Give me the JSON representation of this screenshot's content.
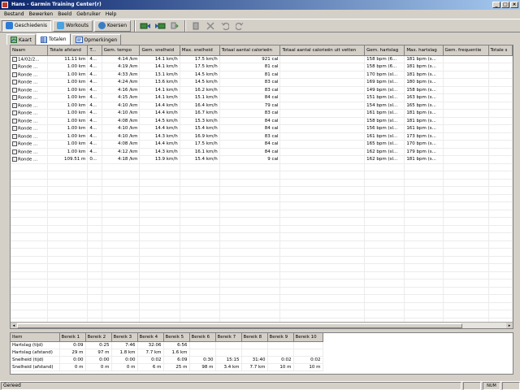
{
  "window": {
    "title": "Hans - Garmin Training Center(r)",
    "min": "_",
    "max": "□",
    "close": "×"
  },
  "menu": [
    "Bestand",
    "Bewerken",
    "Beeld",
    "Gebruiker",
    "Help"
  ],
  "toolbar": {
    "tabs": [
      {
        "label": "Geschiedenis",
        "active": true,
        "color": "#2e7bd6"
      },
      {
        "label": "Workouts",
        "active": false,
        "color": "#4aa3e0"
      },
      {
        "label": "Koersen",
        "active": false,
        "color": "#3b7dc4"
      }
    ]
  },
  "subtabs": [
    {
      "label": "Kaart",
      "active": false
    },
    {
      "label": "Totalen",
      "active": true
    },
    {
      "label": "Opmerkingen",
      "active": false
    }
  ],
  "grid": {
    "columns": [
      "Naam",
      "Totale afstand",
      "T...",
      "Gem. tempo",
      "Gem. snelheid",
      "Max. snelheid",
      "Totaal aantal calorieën",
      "Totaal aantal calorieën uit vetten",
      "Gem. hartslag",
      "Max. hartslag",
      "Gem. frequentie",
      "Totale s"
    ],
    "rows": [
      [
        "14/02/2...",
        "11.11 km",
        "4...",
        "4:14 /km",
        "14.1 km/h",
        "17.5 km/h",
        "921 cal",
        "",
        "158 bpm (6...",
        "181 bpm (s...",
        "",
        ""
      ],
      [
        "Ronde ...",
        "1.00 km",
        "4...",
        "4:19 /km",
        "14.1 km/h",
        "17.5 km/h",
        "81 cal",
        "",
        "158 bpm (6...",
        "181 bpm (s...",
        "",
        ""
      ],
      [
        "Ronde ...",
        "1.00 km",
        "4...",
        "4:33 /km",
        "13.1 km/h",
        "14.5 km/h",
        "81 cal",
        "",
        "170 bpm (sl...",
        "181 bpm (s...",
        "",
        ""
      ],
      [
        "Ronde ...",
        "1.00 km",
        "4...",
        "4:24 /km",
        "13.6 km/h",
        "14.5 km/h",
        "83 cal",
        "",
        "169 bpm (sl...",
        "180 bpm (s...",
        "",
        ""
      ],
      [
        "Ronde ...",
        "1.00 km",
        "4...",
        "4:16 /km",
        "14.1 km/h",
        "16.2 km/h",
        "83 cal",
        "",
        "149 bpm (sl...",
        "158 bpm (s...",
        "",
        ""
      ],
      [
        "Ronde ...",
        "1.00 km",
        "4...",
        "4:15 /km",
        "14.1 km/h",
        "15.1 km/h",
        "84 cal",
        "",
        "151 bpm (sl...",
        "163 bpm (s...",
        "",
        ""
      ],
      [
        "Ronde ...",
        "1.00 km",
        "4...",
        "4:10 /km",
        "14.4 km/h",
        "16.4 km/h",
        "79 cal",
        "",
        "154 bpm (sl...",
        "165 bpm (s...",
        "",
        ""
      ],
      [
        "Ronde ...",
        "1.00 km",
        "4...",
        "4:10 /km",
        "14.4 km/h",
        "16.7 km/h",
        "83 cal",
        "",
        "161 bpm (sl...",
        "181 bpm (s...",
        "",
        ""
      ],
      [
        "Ronde ...",
        "1.00 km",
        "4...",
        "4:08 /km",
        "14.5 km/h",
        "15.3 km/h",
        "84 cal",
        "",
        "158 bpm (sl...",
        "181 bpm (s...",
        "",
        ""
      ],
      [
        "Ronde ...",
        "1.00 km",
        "4...",
        "4:10 /km",
        "14.4 km/h",
        "15.4 km/h",
        "84 cal",
        "",
        "156 bpm (sl...",
        "161 bpm (s...",
        "",
        ""
      ],
      [
        "Ronde ...",
        "1.00 km",
        "4...",
        "4:10 /km",
        "14.3 km/h",
        "16.9 km/h",
        "83 cal",
        "",
        "161 bpm (sl...",
        "173 bpm (s...",
        "",
        ""
      ],
      [
        "Ronde ...",
        "1.00 km",
        "4...",
        "4:08 /km",
        "14.4 km/h",
        "17.5 km/h",
        "84 cal",
        "",
        "165 bpm (sl...",
        "170 bpm (s...",
        "",
        ""
      ],
      [
        "Ronde ...",
        "1.00 km",
        "4...",
        "4:12 /km",
        "14.3 km/h",
        "16.1 km/h",
        "84 cal",
        "",
        "162 bpm (sl...",
        "179 bpm (s...",
        "",
        ""
      ],
      [
        "Ronde ...",
        "109.51 m",
        "0...",
        "4:18 /km",
        "13.9 km/h",
        "15.4 km/h",
        "9 cal",
        "",
        "162 bpm (sl...",
        "181 bpm (s...",
        "",
        ""
      ]
    ]
  },
  "zones": {
    "columns": [
      "Item",
      "Bereik 1",
      "Bereik 2",
      "Bereik 3",
      "Bereik 4",
      "Bereik 5",
      "Bereik 6",
      "Bereik 7",
      "Bereik 8",
      "Bereik 9",
      "Bereik 10"
    ],
    "rows": [
      [
        "Hartslag (tijd)",
        "0:09",
        "0:25",
        "7:46",
        "32:06",
        "6:56",
        "",
        "",
        "",
        "",
        ""
      ],
      [
        "Hartslag (afstand)",
        "29 m",
        "97 m",
        "1.8 km",
        "7.7 km",
        "1.6 km",
        "",
        "",
        "",
        "",
        ""
      ],
      [
        "Snelheid (tijd)",
        "0:00",
        "0:00",
        "0:00",
        "0:02",
        "6:09",
        "0:30",
        "15:15",
        "31:40",
        "0:02",
        "0:02"
      ],
      [
        "Snelheid (afstand)",
        "0 m",
        "0 m",
        "0 m",
        "6 m",
        "25 m",
        "98 m",
        "3.4 km",
        "7.7 km",
        "10 m",
        "10 m"
      ]
    ]
  },
  "status": {
    "text": "Gereed",
    "cells": [
      "",
      "NUM",
      ""
    ]
  }
}
